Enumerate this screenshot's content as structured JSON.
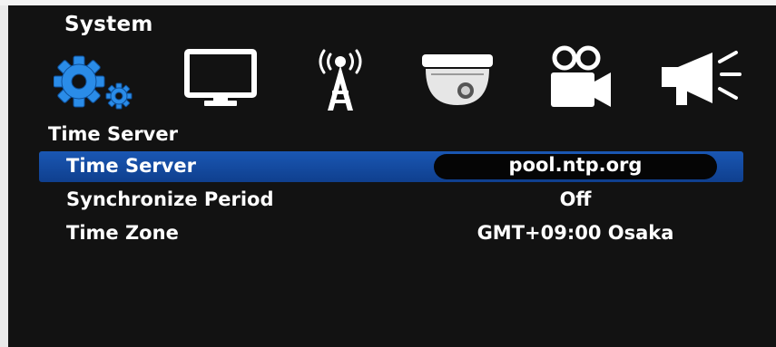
{
  "header": {
    "title": "System"
  },
  "toolbar": {
    "icons": [
      {
        "name": "system-gear-icon"
      },
      {
        "name": "display-monitor-icon"
      },
      {
        "name": "network-antenna-icon"
      },
      {
        "name": "dome-camera-icon"
      },
      {
        "name": "recording-camera-icon"
      },
      {
        "name": "alarm-megaphone-icon"
      }
    ]
  },
  "panel": {
    "subheader": "Time Server",
    "rows": [
      {
        "label": "Time Server",
        "value": "pool.ntp.org",
        "selected": true
      },
      {
        "label": "Synchronize Period",
        "value": "Off",
        "selected": false
      },
      {
        "label": "Time Zone",
        "value": "GMT+09:00 Osaka",
        "selected": false
      }
    ]
  },
  "colors": {
    "background": "#121212",
    "selection": "#1a57b3",
    "accent_icon": "#2a8ce8",
    "text": "#ffffff"
  }
}
